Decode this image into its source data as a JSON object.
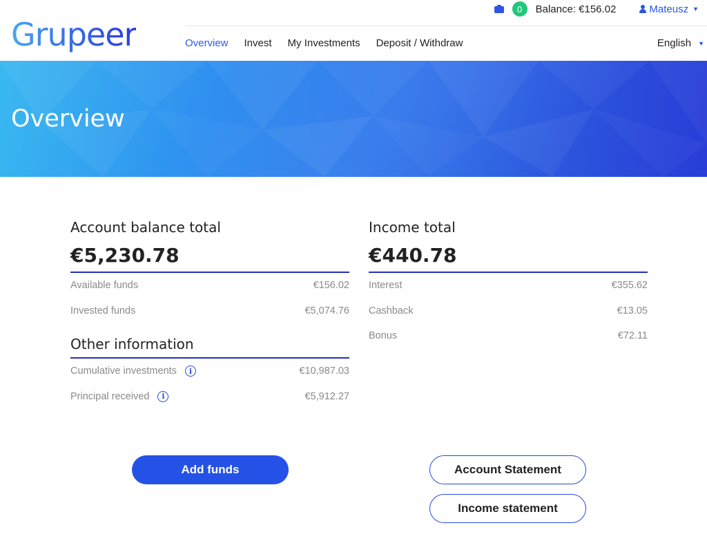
{
  "brand": {
    "logo_text": "Grupeer"
  },
  "topbar": {
    "badge_count": "0",
    "balance_label": "Balance: €156.02",
    "user_name": "Mateusz"
  },
  "nav": {
    "items": [
      {
        "label": "Overview",
        "active": true
      },
      {
        "label": "Invest",
        "active": false
      },
      {
        "label": "My Investments",
        "active": false
      },
      {
        "label": "Deposit / Withdraw",
        "active": false
      }
    ],
    "language": "English"
  },
  "banner": {
    "title": "Overview"
  },
  "account": {
    "title": "Account balance total",
    "total": "€5,230.78",
    "rows": [
      {
        "label": "Available funds",
        "value": "€156.02"
      },
      {
        "label": "Invested funds",
        "value": "€5,074.76"
      }
    ]
  },
  "other": {
    "title": "Other information",
    "rows": [
      {
        "label": "Cumulative investments",
        "value": "€10,987.03"
      },
      {
        "label": "Principal received",
        "value": "€5,912.27"
      }
    ]
  },
  "income": {
    "title": "Income total",
    "total": "€440.78",
    "rows": [
      {
        "label": "Interest",
        "value": "€355.62"
      },
      {
        "label": "Cashback",
        "value": "€13.05"
      },
      {
        "label": "Bonus",
        "value": "€72.11"
      }
    ]
  },
  "buttons": {
    "add_funds": "Add funds",
    "account_statement": "Account Statement",
    "income_statement": "Income statement"
  },
  "icons": {
    "wallet": "wallet-icon",
    "user": "user-icon",
    "info": "info-icon",
    "caret": "caret-down-icon"
  },
  "colors": {
    "accent": "#2552e6",
    "badge": "#22c77a",
    "underline": "#2230b8"
  }
}
